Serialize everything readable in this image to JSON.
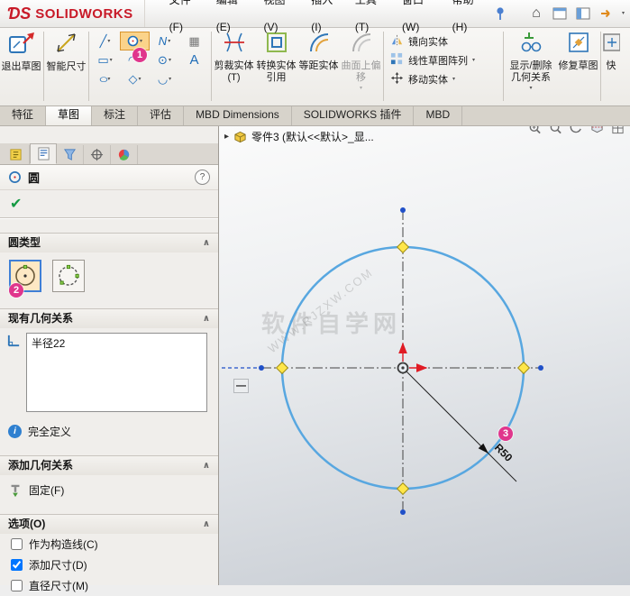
{
  "titlebar": {
    "logo_prefix": "ƊS",
    "logo_text": "SOLIDWORKS",
    "menus": [
      "文件(F)",
      "编辑(E)",
      "视图(V)",
      "插入(I)",
      "工具(T)",
      "窗口(W)",
      "帮助(H)"
    ]
  },
  "ribbon": {
    "exit_sketch": "退出草图",
    "smart_dimension": "智能尺寸",
    "trim": "剪裁实体(T)",
    "convert": "转换实体引用",
    "offset": "等距实体",
    "surface_offset": "曲面上偏移",
    "mirror": "镜向实体",
    "linear_pattern": "线性草图阵列",
    "move": "移动实体",
    "display_delete": "显示/删除几何关系",
    "repair": "修复草图",
    "clipped": "快"
  },
  "tabs": [
    "特征",
    "草图",
    "标注",
    "评估",
    "MBD Dimensions",
    "SOLIDWORKS 插件",
    "MBD"
  ],
  "panel": {
    "title": "圆",
    "circle_type": "圆类型",
    "existing_relations": "现有几何关系",
    "relation_item": "半径22",
    "status": "完全定义",
    "add_relations": "添加几何关系",
    "fix": "固定(F)",
    "options_header": "选项(O)",
    "options": [
      {
        "label": "作为构造线(C)",
        "checked": false
      },
      {
        "label": "添加尺寸(D)",
        "checked": true
      },
      {
        "label": "直径尺寸(M)",
        "checked": false
      }
    ]
  },
  "graphics": {
    "tree_item": "零件3 (默认<<默认>_显...",
    "radius_label": "R50",
    "watermark_cn": "软件自学网",
    "watermark_url": "WWW.RJZXW.COM"
  },
  "badges": {
    "b1": "1",
    "b2": "2",
    "b3": "3"
  },
  "icons": {
    "line": "╱",
    "spline": "N",
    "grid": "▦",
    "rect": "▭",
    "arc": "◠",
    "point": "⊙",
    "text_tool": "A",
    "ellipse": "○",
    "polygon": "◇",
    "fillet": "◡",
    "caret": "▾",
    "chevron": "∧",
    "tree_arrow": "▸",
    "check": "✔",
    "help": "?",
    "info": "i",
    "minus": "—",
    "home": "⌂"
  }
}
